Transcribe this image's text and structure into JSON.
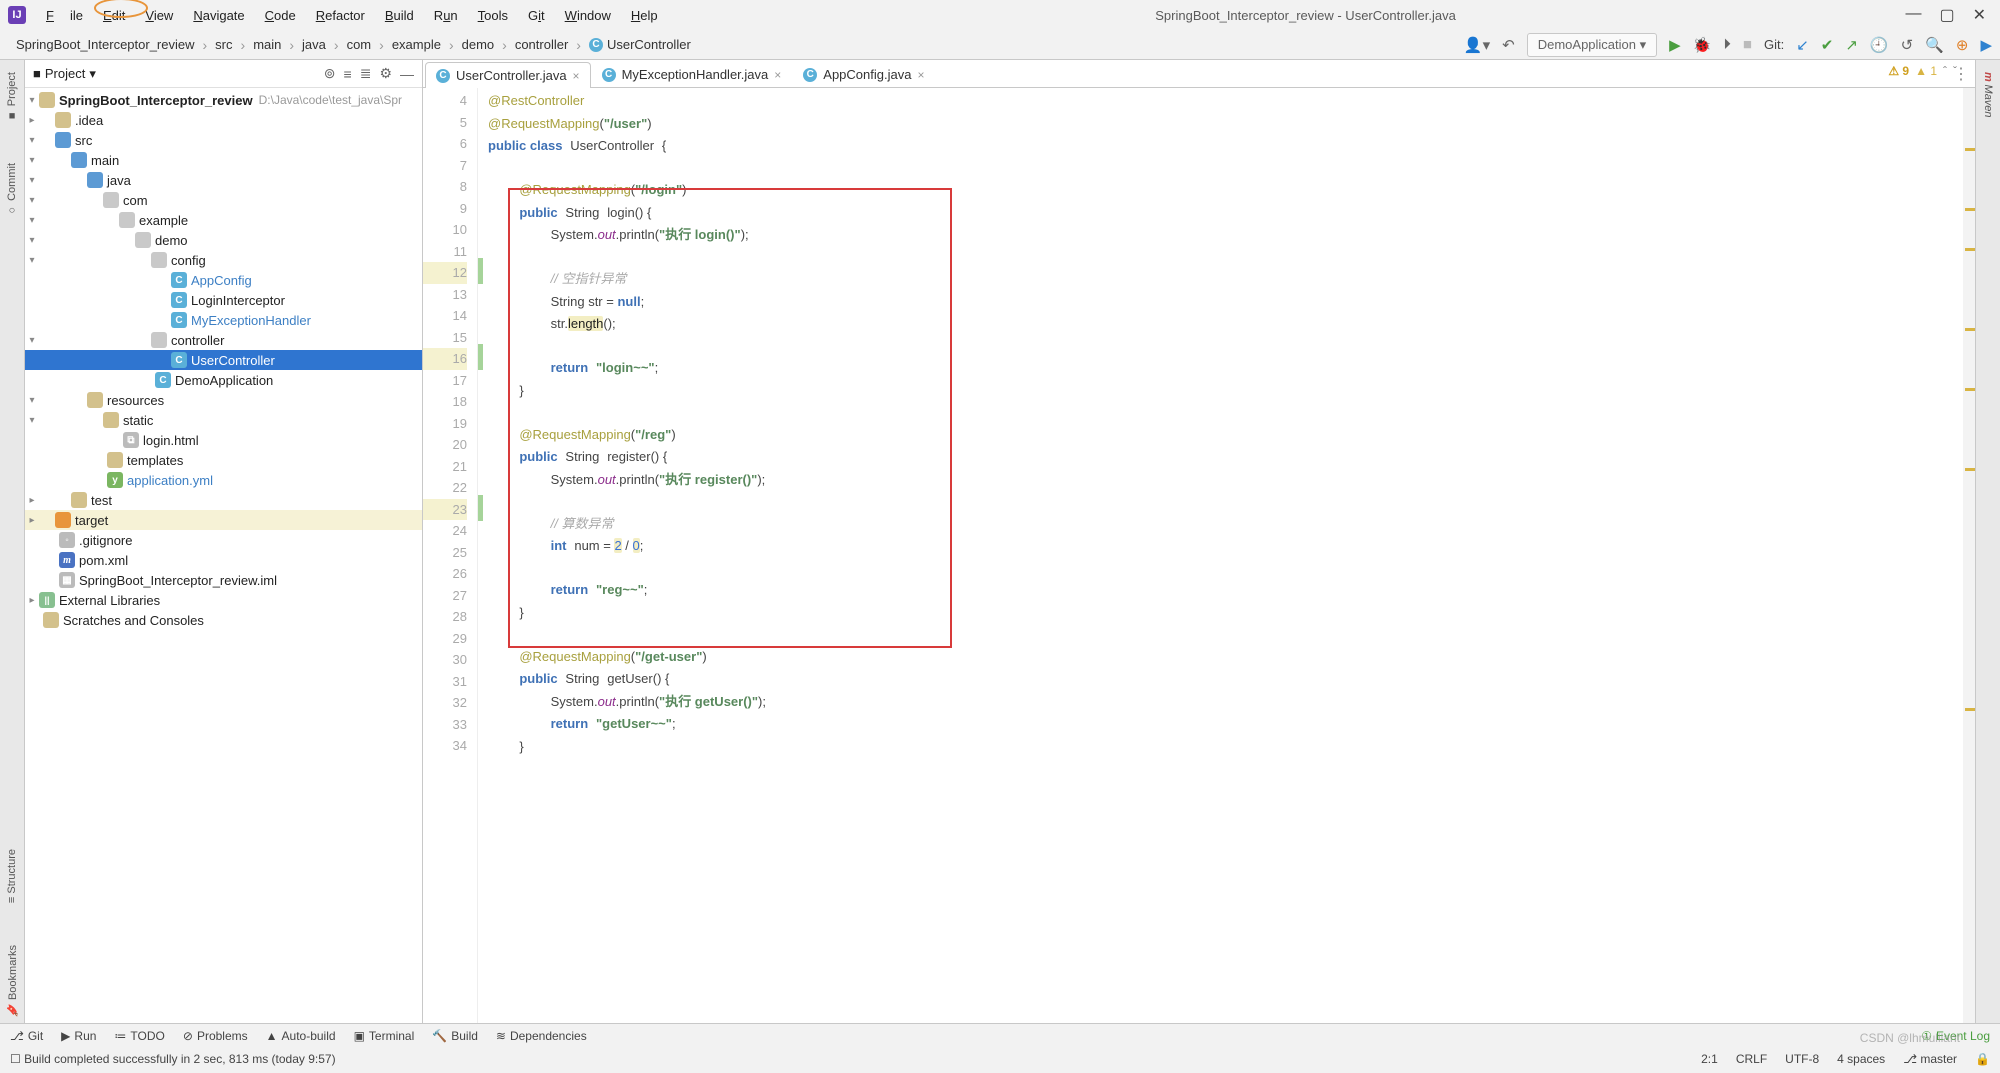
{
  "title": "SpringBoot_Interceptor_review - UserController.java",
  "menu": [
    "File",
    "Edit",
    "View",
    "Navigate",
    "Code",
    "Refactor",
    "Build",
    "Run",
    "Tools",
    "Git",
    "Window",
    "Help"
  ],
  "breadcrumbs": [
    "SpringBoot_Interceptor_review",
    "src",
    "main",
    "java",
    "com",
    "example",
    "demo",
    "controller",
    "UserController"
  ],
  "run_config": "DemoApplication",
  "git_label": "Git:",
  "sidebar": {
    "title": "Project",
    "root": {
      "name": "SpringBoot_Interceptor_review",
      "path": "D:\\Java\\code\\test_java\\Spr"
    },
    "nodes": [
      ".idea",
      "src",
      "main",
      "java",
      "com",
      "example",
      "demo",
      "config",
      "AppConfig",
      "LoginInterceptor",
      "MyExceptionHandler",
      "controller",
      "UserController",
      "DemoApplication",
      "resources",
      "static",
      "login.html",
      "templates",
      "application.yml",
      "test",
      "target",
      ".gitignore",
      "pom.xml",
      "SpringBoot_Interceptor_review.iml",
      "External Libraries",
      "Scratches and Consoles"
    ]
  },
  "tabs": [
    {
      "name": "UserController.java",
      "active": true
    },
    {
      "name": "MyExceptionHandler.java",
      "active": false
    },
    {
      "name": "AppConfig.java",
      "active": false
    }
  ],
  "code_lines": {
    "start": 4,
    "end": 34,
    "l5": "@RestController",
    "l6a": "@RequestMapping",
    "l6b": "(\"/user\")",
    "l7": "public class UserController {",
    "l9a": "@RequestMapping",
    "l9b": "(\"/login\")",
    "l10": "public String login() {",
    "l11a": "System.",
    "l11b": "out",
    "l11c": ".println(",
    "l11d": "\"执行 login()\"",
    "l11e": ");",
    "l13": "// 空指针异常",
    "l14": "String str = null;",
    "l15a": "str.",
    "l15b": "length",
    "l15c": "();",
    "l17a": "return ",
    "l17b": "\"login~~\"",
    "l17c": ";",
    "l18": "}",
    "l20a": "@RequestMapping",
    "l20b": "(\"/reg\")",
    "l21": "public String register() {",
    "l22a": "System.",
    "l22b": "out",
    "l22c": ".println(",
    "l22d": "\"执行 register()\"",
    "l22e": ");",
    "l24": "// 算数异常",
    "l25a": "int ",
    "l25b": "num = ",
    "l25c": "2",
    "l25d": " / ",
    "l25e": "0",
    "l25f": ";",
    "l27a": "return ",
    "l27b": "\"reg~~\"",
    "l27c": ";",
    "l28": "}",
    "l30a": "@RequestMapping",
    "l30b": "(\"/get-user\")",
    "l31": "public String getUser() {",
    "l32a": "System.",
    "l32b": "out",
    "l32c": ".println(",
    "l32d": "\"执行 getUser()\"",
    "l32e": ");",
    "l33a": "return ",
    "l33b": "\"getUser~~\"",
    "l33c": ";",
    "l34": "}"
  },
  "inspections": {
    "errors": "9",
    "warnings": "1"
  },
  "bottom_tools": [
    "Git",
    "Run",
    "TODO",
    "Problems",
    "Auto-build",
    "Terminal",
    "Build",
    "Dependencies"
  ],
  "event_log": "Event Log",
  "status": {
    "msg": "Build completed successfully in 2 sec, 813 ms (today 9:57)",
    "pos": "2:1",
    "le": "CRLF",
    "enc": "UTF-8",
    "indent": "4 spaces",
    "branch": "master"
  },
  "left_tabs": [
    "Project",
    "Commit",
    "Structure",
    "Bookmarks"
  ],
  "right_tab": "Maven",
  "watermark": "CSDN @lhmulilant"
}
